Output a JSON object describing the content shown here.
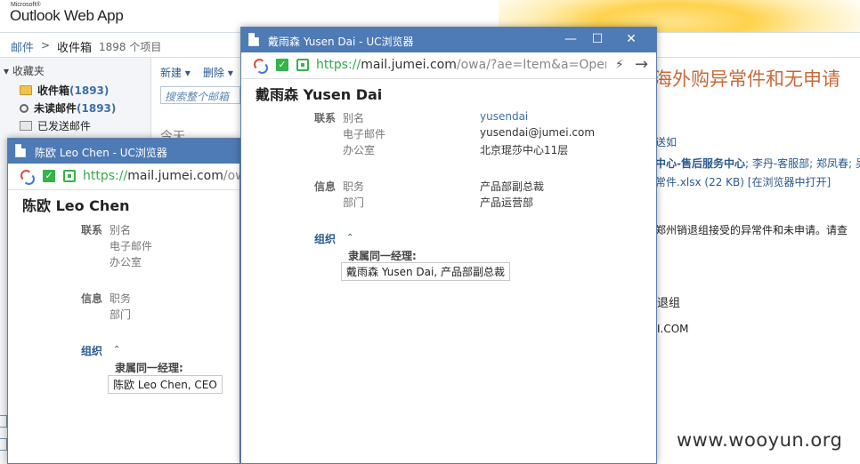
{
  "owa": {
    "logo_small": "Microsoft®",
    "logo": "Outlook Web App",
    "crumb_mail": "邮件",
    "crumb_sep": ">",
    "crumb_inbox": "收件箱",
    "crumb_count": "1898 个项目",
    "favorites_header": "收藏夹",
    "favorites": [
      {
        "label": "收件箱",
        "count": "(1893)"
      },
      {
        "label": "未读邮件",
        "count": "(1893)"
      },
      {
        "label": "已发送邮件",
        "count": ""
      }
    ],
    "tool_new": "新建 ▾",
    "tool_delete": "删除 ▾",
    "search_placeholder": "搜索整个邮箱",
    "today": "今天",
    "reading": {
      "subject": "海外购异常件和无申请",
      "cc": "送如",
      "to_bold": "中心-售后服务中心",
      "to_rest": "; 李丹-客服部; 郑凤春; 吴",
      "attachment": "常件.xlsx (22 KB) [在浏览器中打开]",
      "body1": "郑州销退组接受的异常件和未申请。请查",
      "body2": "退组",
      "body3": "I.COM",
      "watermark": "www.wooyun.org"
    }
  },
  "window1": {
    "title": "陈欧 Leo Chen - UC浏览器",
    "url_https": "https://",
    "url_host": "mail.jumei.com",
    "url_rest": "/ow",
    "name": "陈欧 Leo Chen",
    "contact_section": "联系",
    "alias_label": "别名",
    "email_label": "电子邮件",
    "office_label": "办公室",
    "info_section": "信息",
    "title_label": "职务",
    "dept_label": "部门",
    "org_section": "组织",
    "caret": "⌃",
    "manager_label": "隶属同一经理:",
    "manager": "陈欧 Leo Chen, CEO"
  },
  "window2": {
    "title": "戴雨森 Yusen Dai - UC浏览器",
    "url_https": "https://",
    "url_host": "mail.jumei.com",
    "url_rest": "/owa/?ae=Item&a=Open&",
    "name": "戴雨森 Yusen Dai",
    "contact_section": "联系",
    "alias_label": "别名",
    "alias": "yusendai",
    "email_label": "电子邮件",
    "email": "yusendai@jumei.com",
    "office_label": "办公室",
    "office": "北京琨莎中心11层",
    "info_section": "信息",
    "title_label": "职务",
    "job_title": "产品部副总裁",
    "dept_label": "部门",
    "dept": "产品运营部",
    "org_section": "组织",
    "caret": "⌃",
    "manager_label": "隶属同一经理:",
    "manager": "戴雨森 Yusen Dai, 产品部副总裁"
  },
  "icons": {
    "minimize": "—",
    "maximize": "☐",
    "close": "✕",
    "bolt": "⚡",
    "forward": "→",
    "check": "✓"
  }
}
